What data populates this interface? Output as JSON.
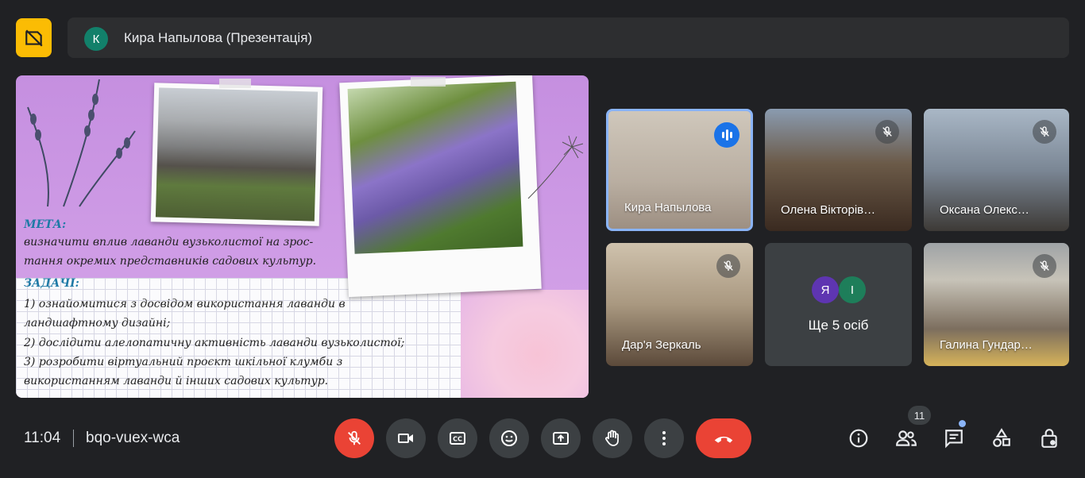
{
  "presentation": {
    "presenter_initial": "К",
    "title": "Кира Напылова (Презентація)",
    "slide": {
      "goal_heading": "МЕТА:",
      "goal_lines": [
        "визначити вплив лаванди вузьколистої на зрос-",
        "тання окремих представників садових культур."
      ],
      "tasks_heading": "ЗАДАЧІ:",
      "task_lines": [
        "1) ознайомитися з досвідом використання лаванди в",
        "ландшафтному дизайні;",
        "2) дослідити алелопатичну активність лаванди вузьколистої;",
        "3) розробити віртуальний проєкт шкільної клумби з",
        "використанням лаванди й інших садових культур."
      ]
    }
  },
  "participants": [
    {
      "name": "Кира Напылова",
      "state": "speaking"
    },
    {
      "name": "Олена Вікторів…",
      "state": "muted"
    },
    {
      "name": "Оксана Олекс…",
      "state": "muted"
    },
    {
      "name": "Дар'я Зеркаль",
      "state": "muted"
    },
    {
      "name": "Галина Гундар…",
      "state": "muted"
    }
  ],
  "others": {
    "initials": [
      "Я",
      "І"
    ],
    "label": "Ще 5 осіб"
  },
  "footer": {
    "time": "11:04",
    "meeting_code": "bqo-vuex-wca",
    "participant_count": "11"
  },
  "colors": {
    "background": "#202124",
    "control": "#3c4043",
    "danger": "#ea4335",
    "accent": "#1a73e8",
    "present": "#fbbc04"
  }
}
